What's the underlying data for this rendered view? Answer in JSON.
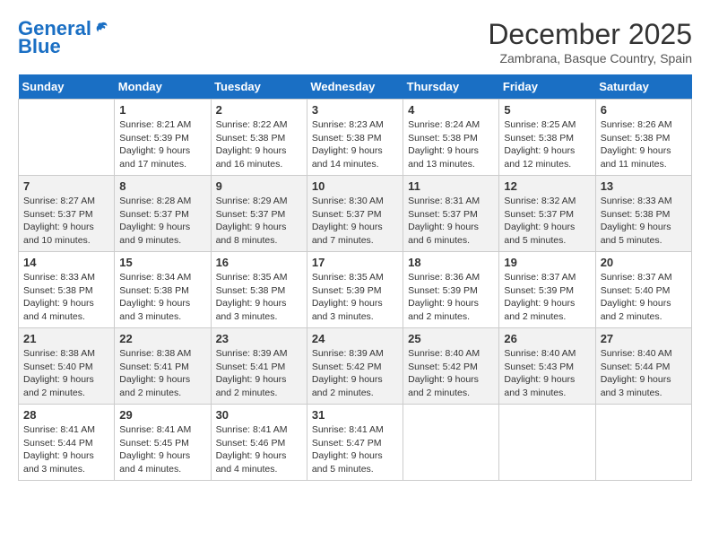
{
  "header": {
    "logo_line1": "General",
    "logo_line2": "Blue",
    "month": "December 2025",
    "location": "Zambrana, Basque Country, Spain"
  },
  "days_of_week": [
    "Sunday",
    "Monday",
    "Tuesday",
    "Wednesday",
    "Thursday",
    "Friday",
    "Saturday"
  ],
  "weeks": [
    [
      {
        "day": "",
        "info": ""
      },
      {
        "day": "1",
        "info": "Sunrise: 8:21 AM\nSunset: 5:39 PM\nDaylight: 9 hours\nand 17 minutes."
      },
      {
        "day": "2",
        "info": "Sunrise: 8:22 AM\nSunset: 5:38 PM\nDaylight: 9 hours\nand 16 minutes."
      },
      {
        "day": "3",
        "info": "Sunrise: 8:23 AM\nSunset: 5:38 PM\nDaylight: 9 hours\nand 14 minutes."
      },
      {
        "day": "4",
        "info": "Sunrise: 8:24 AM\nSunset: 5:38 PM\nDaylight: 9 hours\nand 13 minutes."
      },
      {
        "day": "5",
        "info": "Sunrise: 8:25 AM\nSunset: 5:38 PM\nDaylight: 9 hours\nand 12 minutes."
      },
      {
        "day": "6",
        "info": "Sunrise: 8:26 AM\nSunset: 5:38 PM\nDaylight: 9 hours\nand 11 minutes."
      }
    ],
    [
      {
        "day": "7",
        "info": "Sunrise: 8:27 AM\nSunset: 5:37 PM\nDaylight: 9 hours\nand 10 minutes."
      },
      {
        "day": "8",
        "info": "Sunrise: 8:28 AM\nSunset: 5:37 PM\nDaylight: 9 hours\nand 9 minutes."
      },
      {
        "day": "9",
        "info": "Sunrise: 8:29 AM\nSunset: 5:37 PM\nDaylight: 9 hours\nand 8 minutes."
      },
      {
        "day": "10",
        "info": "Sunrise: 8:30 AM\nSunset: 5:37 PM\nDaylight: 9 hours\nand 7 minutes."
      },
      {
        "day": "11",
        "info": "Sunrise: 8:31 AM\nSunset: 5:37 PM\nDaylight: 9 hours\nand 6 minutes."
      },
      {
        "day": "12",
        "info": "Sunrise: 8:32 AM\nSunset: 5:37 PM\nDaylight: 9 hours\nand 5 minutes."
      },
      {
        "day": "13",
        "info": "Sunrise: 8:33 AM\nSunset: 5:38 PM\nDaylight: 9 hours\nand 5 minutes."
      }
    ],
    [
      {
        "day": "14",
        "info": "Sunrise: 8:33 AM\nSunset: 5:38 PM\nDaylight: 9 hours\nand 4 minutes."
      },
      {
        "day": "15",
        "info": "Sunrise: 8:34 AM\nSunset: 5:38 PM\nDaylight: 9 hours\nand 3 minutes."
      },
      {
        "day": "16",
        "info": "Sunrise: 8:35 AM\nSunset: 5:38 PM\nDaylight: 9 hours\nand 3 minutes."
      },
      {
        "day": "17",
        "info": "Sunrise: 8:35 AM\nSunset: 5:39 PM\nDaylight: 9 hours\nand 3 minutes."
      },
      {
        "day": "18",
        "info": "Sunrise: 8:36 AM\nSunset: 5:39 PM\nDaylight: 9 hours\nand 2 minutes."
      },
      {
        "day": "19",
        "info": "Sunrise: 8:37 AM\nSunset: 5:39 PM\nDaylight: 9 hours\nand 2 minutes."
      },
      {
        "day": "20",
        "info": "Sunrise: 8:37 AM\nSunset: 5:40 PM\nDaylight: 9 hours\nand 2 minutes."
      }
    ],
    [
      {
        "day": "21",
        "info": "Sunrise: 8:38 AM\nSunset: 5:40 PM\nDaylight: 9 hours\nand 2 minutes."
      },
      {
        "day": "22",
        "info": "Sunrise: 8:38 AM\nSunset: 5:41 PM\nDaylight: 9 hours\nand 2 minutes."
      },
      {
        "day": "23",
        "info": "Sunrise: 8:39 AM\nSunset: 5:41 PM\nDaylight: 9 hours\nand 2 minutes."
      },
      {
        "day": "24",
        "info": "Sunrise: 8:39 AM\nSunset: 5:42 PM\nDaylight: 9 hours\nand 2 minutes."
      },
      {
        "day": "25",
        "info": "Sunrise: 8:40 AM\nSunset: 5:42 PM\nDaylight: 9 hours\nand 2 minutes."
      },
      {
        "day": "26",
        "info": "Sunrise: 8:40 AM\nSunset: 5:43 PM\nDaylight: 9 hours\nand 3 minutes."
      },
      {
        "day": "27",
        "info": "Sunrise: 8:40 AM\nSunset: 5:44 PM\nDaylight: 9 hours\nand 3 minutes."
      }
    ],
    [
      {
        "day": "28",
        "info": "Sunrise: 8:41 AM\nSunset: 5:44 PM\nDaylight: 9 hours\nand 3 minutes."
      },
      {
        "day": "29",
        "info": "Sunrise: 8:41 AM\nSunset: 5:45 PM\nDaylight: 9 hours\nand 4 minutes."
      },
      {
        "day": "30",
        "info": "Sunrise: 8:41 AM\nSunset: 5:46 PM\nDaylight: 9 hours\nand 4 minutes."
      },
      {
        "day": "31",
        "info": "Sunrise: 8:41 AM\nSunset: 5:47 PM\nDaylight: 9 hours\nand 5 minutes."
      },
      {
        "day": "",
        "info": ""
      },
      {
        "day": "",
        "info": ""
      },
      {
        "day": "",
        "info": ""
      }
    ]
  ]
}
